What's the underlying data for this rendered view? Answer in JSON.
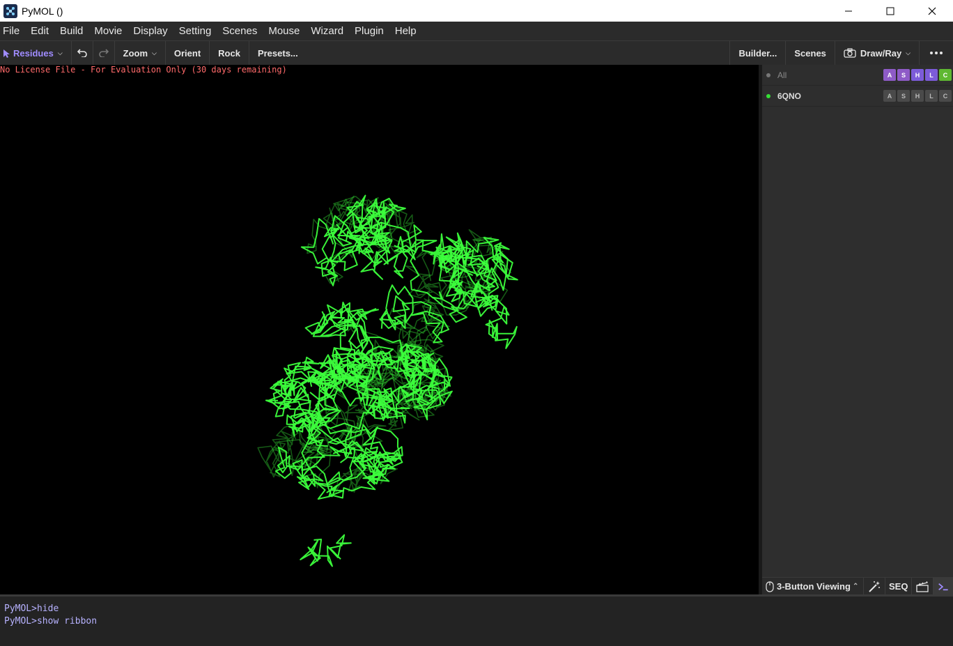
{
  "window": {
    "title": "PyMOL ()"
  },
  "menu": [
    "File",
    "Edit",
    "Build",
    "Movie",
    "Display",
    "Setting",
    "Scenes",
    "Mouse",
    "Wizard",
    "Plugin",
    "Help"
  ],
  "toolbar": {
    "selection_mode": "Residues",
    "zoom": "Zoom",
    "orient": "Orient",
    "rock": "Rock",
    "presets": "Presets...",
    "builder": "Builder...",
    "scenes": "Scenes",
    "draw_ray": "Draw/Ray"
  },
  "viewport": {
    "license_text": "No License File - For Evaluation Only (30 days remaining)",
    "ribbon_color": "#3cff3c"
  },
  "objects": [
    {
      "name": "All",
      "dot_color": "#777777",
      "buttons": [
        "A",
        "S",
        "H",
        "L",
        "C"
      ],
      "colored": true
    },
    {
      "name": "6QNO",
      "dot_color": "#35e035",
      "buttons": [
        "A",
        "S",
        "H",
        "L",
        "C"
      ],
      "colored": false
    }
  ],
  "statusbar": {
    "mouse_mode": "3-Button Viewing",
    "seq": "SEQ"
  },
  "console": [
    "PyMOL>hide",
    "PyMOL>show ribbon"
  ],
  "colors": {
    "A": "#8e5bc7",
    "S": "#8e5bc7",
    "H": "#7c5cd9",
    "L": "#7c5cd9",
    "C": "#5fb832",
    "inactive": "#4a4a4a",
    "accent": "#a08cff"
  }
}
